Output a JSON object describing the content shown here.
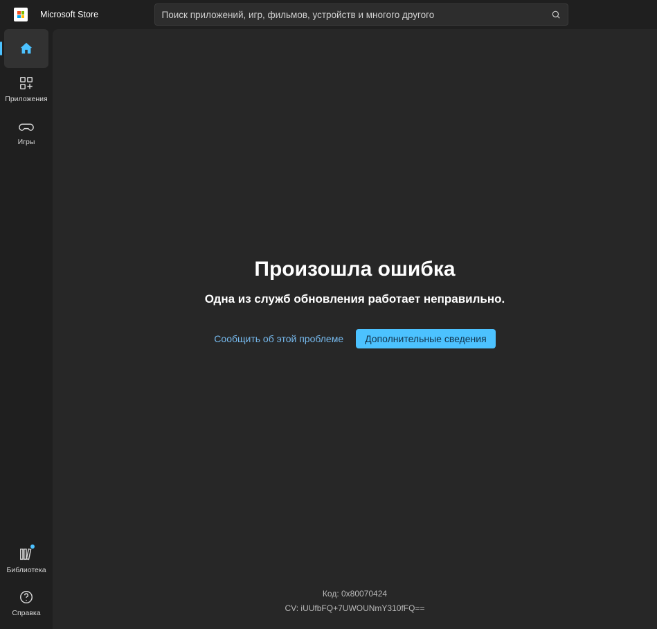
{
  "app": {
    "title": "Microsoft Store"
  },
  "search": {
    "placeholder": "Поиск приложений, игр, фильмов, устройств и многого другого"
  },
  "sidebar": {
    "home": "Главная",
    "apps": "Приложения",
    "games": "Игры",
    "library": "Библиотека",
    "help": "Справка"
  },
  "error": {
    "title": "Произошла ошибка",
    "subtitle": "Одна из служб обновления работает неправильно.",
    "report_label": "Сообщить об этой проблеме",
    "more_label": "Дополнительные сведения",
    "code_line": "Код: 0x80070424",
    "cv_line": "CV: iUUfbFQ+7UWOUNmY310fFQ=="
  }
}
